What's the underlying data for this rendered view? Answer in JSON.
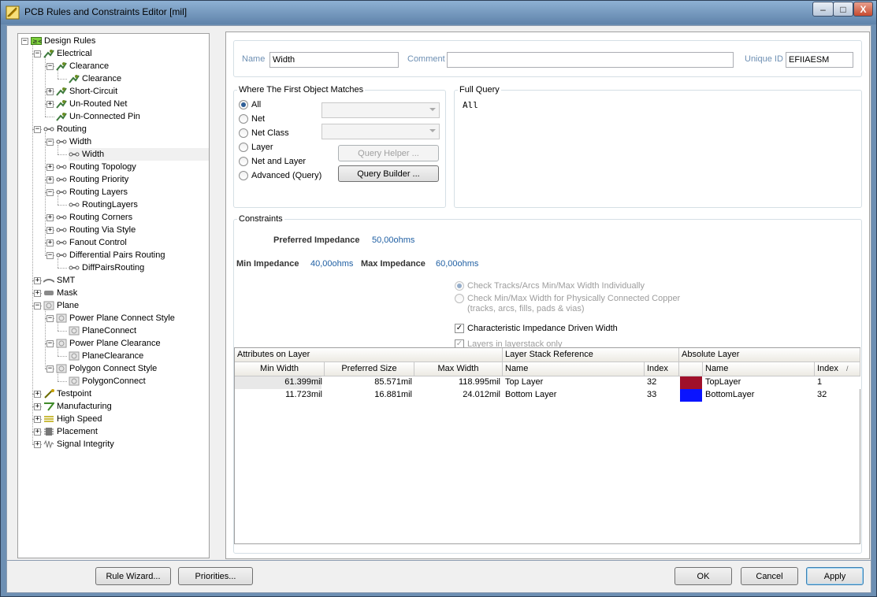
{
  "window": {
    "title": "PCB Rules and Constraints Editor [mil]",
    "minimize": "–",
    "maximize": "□",
    "close": "X"
  },
  "tree": [
    {
      "label": "Design Rules",
      "level": 0,
      "exp": "-",
      "icon": "rules-icon"
    },
    {
      "label": "Electrical",
      "level": 1,
      "exp": "-",
      "icon": "electrical-icon"
    },
    {
      "label": "Clearance",
      "level": 2,
      "exp": "-",
      "icon": "electrical-icon"
    },
    {
      "label": "Clearance",
      "level": 3,
      "exp": "",
      "icon": "electrical-icon"
    },
    {
      "label": "Short-Circuit",
      "level": 2,
      "exp": "+",
      "icon": "electrical-icon"
    },
    {
      "label": "Un-Routed Net",
      "level": 2,
      "exp": "+",
      "icon": "electrical-icon"
    },
    {
      "label": "Un-Connected Pin",
      "level": 2,
      "exp": "",
      "icon": "electrical-icon"
    },
    {
      "label": "Routing",
      "level": 1,
      "exp": "-",
      "icon": "routing-icon"
    },
    {
      "label": "Width",
      "level": 2,
      "exp": "-",
      "icon": "routing-icon"
    },
    {
      "label": "Width",
      "level": 3,
      "exp": "",
      "icon": "routing-icon",
      "selected": true
    },
    {
      "label": "Routing Topology",
      "level": 2,
      "exp": "+",
      "icon": "routing-icon"
    },
    {
      "label": "Routing Priority",
      "level": 2,
      "exp": "+",
      "icon": "routing-icon"
    },
    {
      "label": "Routing Layers",
      "level": 2,
      "exp": "-",
      "icon": "routing-icon"
    },
    {
      "label": "RoutingLayers",
      "level": 3,
      "exp": "",
      "icon": "routing-icon"
    },
    {
      "label": "Routing Corners",
      "level": 2,
      "exp": "+",
      "icon": "routing-icon"
    },
    {
      "label": "Routing Via Style",
      "level": 2,
      "exp": "+",
      "icon": "routing-icon"
    },
    {
      "label": "Fanout Control",
      "level": 2,
      "exp": "+",
      "icon": "routing-icon"
    },
    {
      "label": "Differential Pairs Routing",
      "level": 2,
      "exp": "-",
      "icon": "routing-icon"
    },
    {
      "label": "DiffPairsRouting",
      "level": 3,
      "exp": "",
      "icon": "routing-icon"
    },
    {
      "label": "SMT",
      "level": 1,
      "exp": "+",
      "icon": "smt-icon"
    },
    {
      "label": "Mask",
      "level": 1,
      "exp": "+",
      "icon": "mask-icon"
    },
    {
      "label": "Plane",
      "level": 1,
      "exp": "-",
      "icon": "plane-icon"
    },
    {
      "label": "Power Plane Connect Style",
      "level": 2,
      "exp": "-",
      "icon": "plane-icon"
    },
    {
      "label": "PlaneConnect",
      "level": 3,
      "exp": "",
      "icon": "plane-icon"
    },
    {
      "label": "Power Plane Clearance",
      "level": 2,
      "exp": "-",
      "icon": "plane-icon"
    },
    {
      "label": "PlaneClearance",
      "level": 3,
      "exp": "",
      "icon": "plane-icon"
    },
    {
      "label": "Polygon Connect Style",
      "level": 2,
      "exp": "-",
      "icon": "plane-icon"
    },
    {
      "label": "PolygonConnect",
      "level": 3,
      "exp": "",
      "icon": "plane-icon"
    },
    {
      "label": "Testpoint",
      "level": 1,
      "exp": "+",
      "icon": "testpoint-icon"
    },
    {
      "label": "Manufacturing",
      "level": 1,
      "exp": "+",
      "icon": "manufacturing-icon"
    },
    {
      "label": "High Speed",
      "level": 1,
      "exp": "+",
      "icon": "highspeed-icon"
    },
    {
      "label": "Placement",
      "level": 1,
      "exp": "+",
      "icon": "placement-icon"
    },
    {
      "label": "Signal Integrity",
      "level": 1,
      "exp": "+",
      "icon": "signal-icon"
    }
  ],
  "header": {
    "name_label": "Name",
    "name_value": "Width",
    "comment_label": "Comment",
    "comment_value": "",
    "uid_label": "Unique ID",
    "uid_value": "EFIIAESM"
  },
  "match": {
    "title": "Where The First Object Matches",
    "options": [
      "All",
      "Net",
      "Net Class",
      "Layer",
      "Net and Layer",
      "Advanced (Query)"
    ],
    "selected": "All",
    "query_helper": "Query Helper ...",
    "query_builder": "Query Builder ..."
  },
  "query": {
    "title": "Full Query",
    "text": "All"
  },
  "constraints": {
    "title": "Constraints",
    "pref_label": "Preferred Impedance",
    "pref_value": "50,00ohms",
    "min_label": "Min Impedance",
    "min_value": "40,00ohms",
    "max_label": "Max Impedance",
    "max_value": "60,00ohms",
    "opt1": "Check Tracks/Arcs Min/Max Width Individually",
    "opt2a": "Check Min/Max Width for Physically Connected Copper",
    "opt2b": "(tracks, arcs, fills, pads & vias)",
    "cb1": "Characteristic Impedance Driven Width",
    "cb2": "Layers in layerstack only"
  },
  "grid": {
    "groups": [
      "Attributes on Layer",
      "Layer Stack Reference",
      "Absolute Layer"
    ],
    "cols": [
      "Min Width",
      "Preferred Size",
      "Max Width",
      "Name",
      "Index",
      "",
      "Name",
      "Index"
    ],
    "sort_mark": "/",
    "rows": [
      {
        "min": "61.399mil",
        "pref": "85.571mil",
        "max": "118.995mil",
        "lsname": "Top Layer",
        "lsindex": "32",
        "color": "#a0102a",
        "absname": "TopLayer",
        "absindex": "1"
      },
      {
        "min": "11.723mil",
        "pref": "16.881mil",
        "max": "24.012mil",
        "lsname": "Bottom Layer",
        "lsindex": "33",
        "color": "#0a14ff",
        "absname": "BottomLayer",
        "absindex": "32"
      }
    ]
  },
  "footer": {
    "rule_wizard": "Rule Wizard...",
    "priorities": "Priorities...",
    "ok": "OK",
    "cancel": "Cancel",
    "apply": "Apply"
  }
}
